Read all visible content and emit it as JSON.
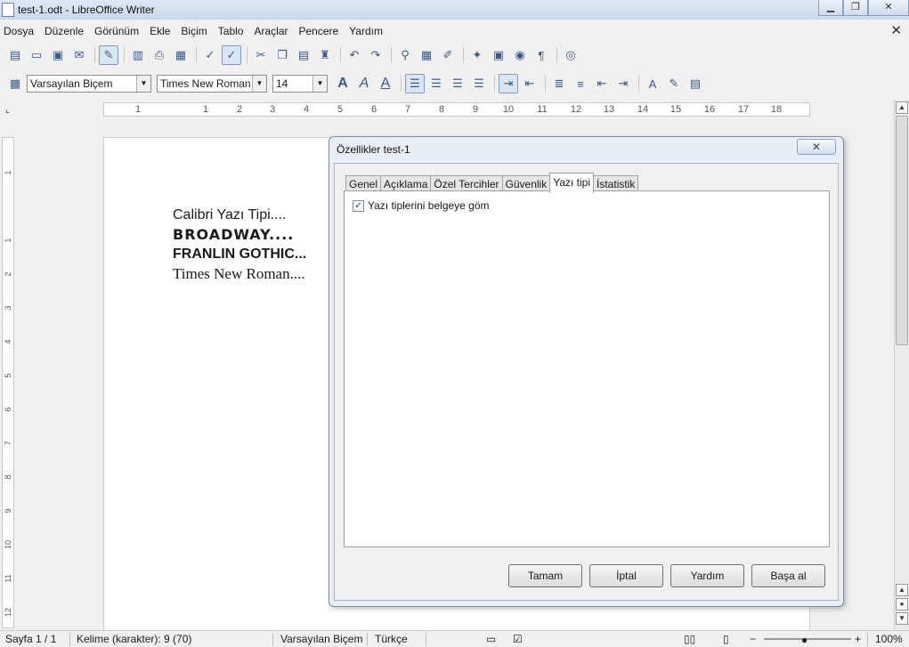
{
  "window": {
    "title": "test-1.odt - LibreOffice Writer"
  },
  "menu": [
    "Dosya",
    "Düzenle",
    "Görünüm",
    "Ekle",
    "Biçim",
    "Tablo",
    "Araçlar",
    "Pencere",
    "Yardım"
  ],
  "format_toolbar": {
    "style": "Varsayılan Biçem",
    "font": "Times New Roman",
    "size": "14"
  },
  "ruler": {
    "numbers": [
      "1",
      "1",
      "2",
      "3",
      "4",
      "5",
      "6",
      "7",
      "8",
      "9",
      "10",
      "11",
      "12",
      "13",
      "14",
      "15",
      "16",
      "17",
      "18"
    ]
  },
  "vruler": {
    "numbers": [
      "1",
      "1",
      "2",
      "3",
      "4",
      "5",
      "6",
      "7",
      "8",
      "9",
      "10",
      "11",
      "12"
    ]
  },
  "document": {
    "lines": [
      "Calibri Yazı Tipi....",
      "BROADWAY....",
      "FRANLIN GOTHIC...",
      "Times New Roman...."
    ]
  },
  "dialog": {
    "title": "Özellikler test-1",
    "close": "✕",
    "tabs": [
      "Genel",
      "Açıklama",
      "Özel Tercihler",
      "Güvenlik",
      "Yazı tipi",
      "İstatistik"
    ],
    "active_tab": "Yazı tipi",
    "checkbox_label": "Yazı tiplerini belgeye göm",
    "checkbox_checked": true,
    "buttons": {
      "ok": "Tamam",
      "cancel": "İptal",
      "help": "Yardım",
      "reset": "Başa al"
    }
  },
  "status": {
    "page": "Sayfa 1 / 1",
    "words": "Kelime (karakter): 9 (70)",
    "style": "Varsayılan Biçem",
    "language": "Türkçe",
    "zoom": "100%"
  }
}
